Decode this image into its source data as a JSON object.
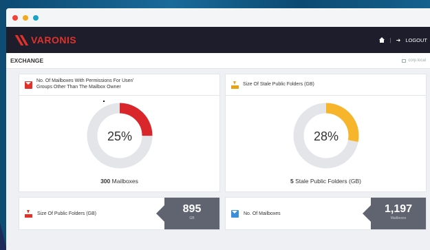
{
  "navbar": {
    "brand": "VARONIS",
    "separator": "|",
    "logout_label": "LOGOUT"
  },
  "subheader": {
    "title": "EXCHANGE",
    "domain": "corp.local"
  },
  "cards": {
    "permissions": {
      "title_line1": "No. Of Mailboxes With Permissions For User/",
      "title_line2": "Groups Other Than The Mailbox Owner",
      "percent": 25,
      "percent_label": "25%",
      "count": "300",
      "count_suffix": "Mailboxes",
      "accent": "#d9262b",
      "track": "#e3e5e9"
    },
    "stale_public": {
      "title": "Size Of Stale Public Folders (GB)",
      "percent": 28,
      "percent_label": "28%",
      "count": "5",
      "count_suffix": "Stale Public Folders (GB)",
      "accent": "#f6b52a",
      "track": "#e3e5e9"
    },
    "public_size": {
      "title": "Size Of Public Folders (GB)",
      "value": "895",
      "unit": "GB"
    },
    "mailboxes": {
      "title": "No. Of Mailboxes",
      "value": "1,197",
      "unit": "Mailboxes"
    }
  },
  "icons": {
    "window_dots": [
      "close-dot",
      "minimize-dot",
      "zoom-dot"
    ],
    "home": "home-icon",
    "logout": "logout-icon",
    "server": "server-icon"
  }
}
